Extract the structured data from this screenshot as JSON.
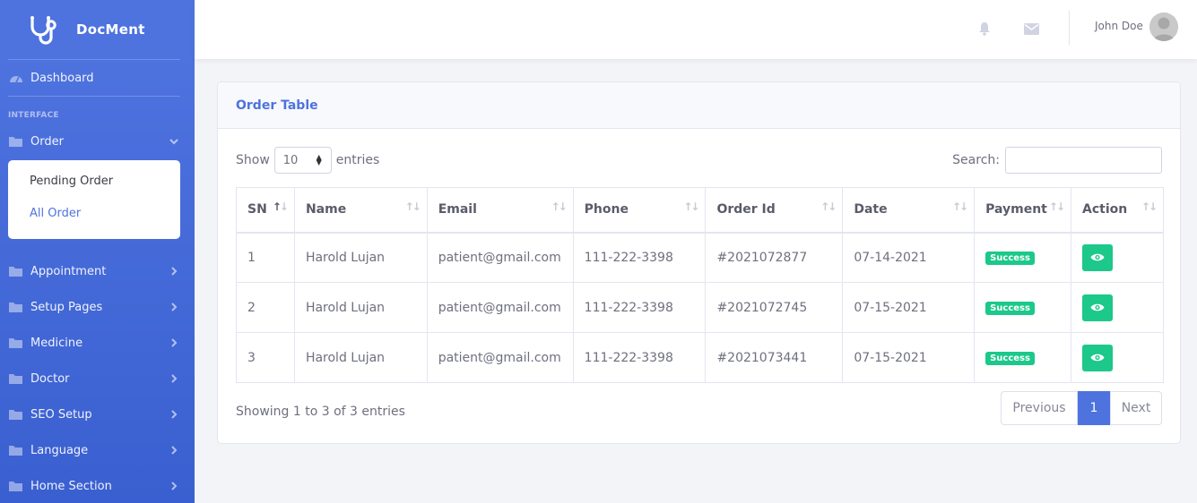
{
  "brand": {
    "name": "DocMent"
  },
  "sidebar": {
    "dashboard": "Dashboard",
    "heading": "INTERFACE",
    "order": {
      "label": "Order",
      "subitems": [
        "Pending Order",
        "All Order"
      ]
    },
    "items": [
      "Appointment",
      "Setup Pages",
      "Medicine",
      "Doctor",
      "SEO Setup",
      "Language",
      "Home Section"
    ]
  },
  "topbar": {
    "user_name": "John Doe",
    "icons": [
      "bell-icon",
      "envelope-icon"
    ]
  },
  "card": {
    "title": "Order Table",
    "show_label": "Show",
    "entries_value": "10",
    "entries_label": "entries",
    "search_label": "Search:",
    "search_value": ""
  },
  "table": {
    "columns": [
      "SN",
      "Name",
      "Email",
      "Phone",
      "Order Id",
      "Date",
      "Payment",
      "Action"
    ],
    "rows": [
      [
        "1",
        "Harold Lujan",
        "patient@gmail.com",
        "111-222-3398",
        "#2021072877",
        "07-14-2021",
        "Success"
      ],
      [
        "2",
        "Harold Lujan",
        "patient@gmail.com",
        "111-222-3398",
        "#2021072745",
        "07-15-2021",
        "Success"
      ],
      [
        "3",
        "Harold Lujan",
        "patient@gmail.com",
        "111-222-3398",
        "#2021073441",
        "07-15-2021",
        "Success"
      ]
    ]
  },
  "footer": {
    "info": "Showing 1 to 3 of 3 entries",
    "previous": "Previous",
    "page": "1",
    "next": "Next"
  },
  "colors": {
    "primary": "#4e73df",
    "success": "#1cc88a"
  }
}
